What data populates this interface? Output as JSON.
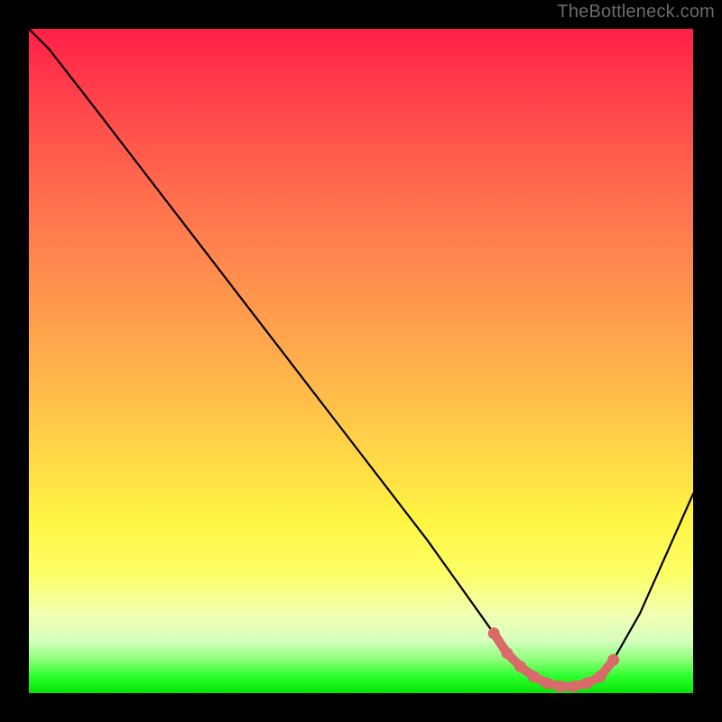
{
  "watermark": "TheBottleneck.com",
  "colors": {
    "frame": "#000000",
    "gradient_top": "#ff1f47",
    "gradient_mid": "#ffd747",
    "gradient_bottom": "#06e406",
    "curve": "#000000",
    "marker": "#d86a6a"
  },
  "chart_data": {
    "type": "line",
    "title": "",
    "xlabel": "",
    "ylabel": "",
    "xlim": [
      0,
      100
    ],
    "ylim": [
      0,
      100
    ],
    "x": [
      0,
      3,
      10,
      20,
      30,
      40,
      50,
      60,
      65,
      70,
      72,
      74,
      76,
      78,
      80,
      82,
      84,
      86,
      88,
      92,
      96,
      100
    ],
    "values": [
      100,
      97,
      88,
      75,
      62,
      49,
      36,
      23,
      16,
      9,
      6,
      4,
      2.5,
      1.5,
      1,
      1,
      1.5,
      2.5,
      5,
      12,
      21,
      30
    ],
    "annotations": {
      "optimal_range_x": [
        70,
        88
      ],
      "marker_points_x": [
        70,
        72,
        74,
        76,
        78,
        80,
        82,
        84,
        86,
        88
      ]
    }
  }
}
